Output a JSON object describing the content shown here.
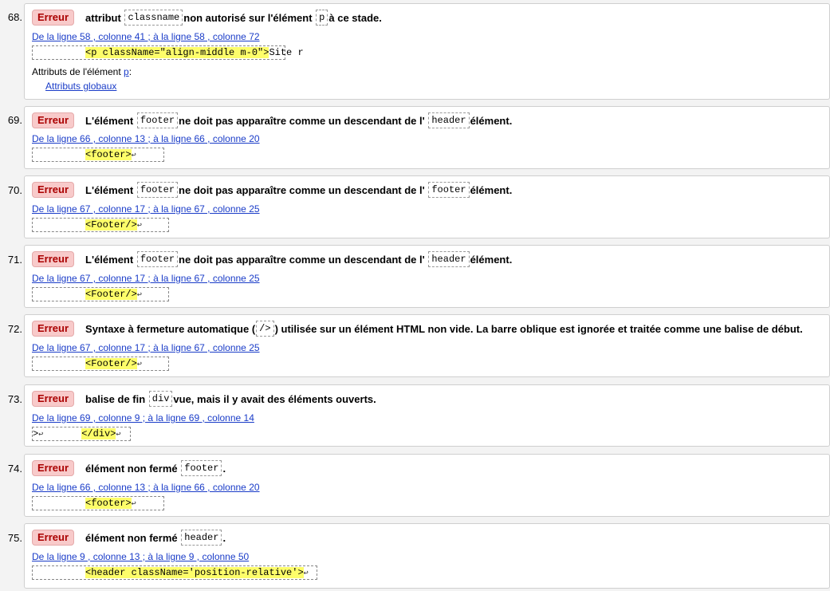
{
  "badge": "Erreur",
  "return_glyph": "↩",
  "messages": [
    {
      "num": "68.",
      "pre": "attribut",
      "code1": "classname",
      "mid": "non autorisé sur l'élément",
      "code2": "p",
      "post": "à ce stade.",
      "location": "De la ligne 58 , colonne 41 ; à la ligne 58 , colonne 72",
      "extract_hl": "<p className=\"align-middle m-0\">",
      "extract_after": "Site r",
      "attrs_label": "Attributs de l'élément",
      "attrs_el": "p",
      "attrs_colon": ":",
      "attrs_link": "Attributs globaux"
    },
    {
      "num": "69.",
      "pre": "L'élément",
      "code1": "footer",
      "mid": "ne doit pas apparaître comme un descendant de l'",
      "code2": "header",
      "post": "élément.",
      "location": "De la ligne 66 , colonne 13 ; à la ligne 66 , colonne 20",
      "extract_hl": "<footer>"
    },
    {
      "num": "70.",
      "pre": "L'élément",
      "code1": "footer",
      "mid": "ne doit pas apparaître comme un descendant de l'",
      "code2": "footer",
      "post": "élément.",
      "location": "De la ligne 67 , colonne 17 ; à la ligne 67 , colonne 25",
      "extract_hl": "<Footer/>"
    },
    {
      "num": "71.",
      "pre": "L'élément",
      "code1": "footer",
      "mid": "ne doit pas apparaître comme un descendant de l'",
      "code2": "header",
      "post": "élément.",
      "location": "De la ligne 67 , colonne 17 ; à la ligne 67 , colonne 25",
      "extract_hl": "<Footer/>"
    },
    {
      "num": "72.",
      "pre": "Syntaxe à fermeture automatique (",
      "code1": "/>",
      "mid": ") utilisée sur un élément HTML non vide. La barre oblique est ignorée et traitée comme une balise de début.",
      "location": "De la ligne 67 , colonne 17 ; à la ligne 67 , colonne 25",
      "extract_hl": "<Footer/>"
    },
    {
      "num": "73.",
      "pre": "balise de fin",
      "code1": "div",
      "mid": "vue, mais il y avait des éléments ouverts.",
      "location": "De la ligne 69 , colonne 9 ; à la ligne 69 , colonne 14",
      "extract_before": ">",
      "extract_hl": "</div>"
    },
    {
      "num": "74.",
      "pre": "élément non fermé",
      "code1": "footer",
      "mid": ".",
      "location": "De la ligne 66 , colonne 13 ; à la ligne 66 , colonne 20",
      "extract_hl": "<footer>"
    },
    {
      "num": "75.",
      "pre": "élément non fermé",
      "code1": "header",
      "mid": ".",
      "location": "De la ligne 9 , colonne 13 ; à la ligne 9 , colonne 50",
      "extract_hl": "<header className='position-relative'>"
    }
  ]
}
